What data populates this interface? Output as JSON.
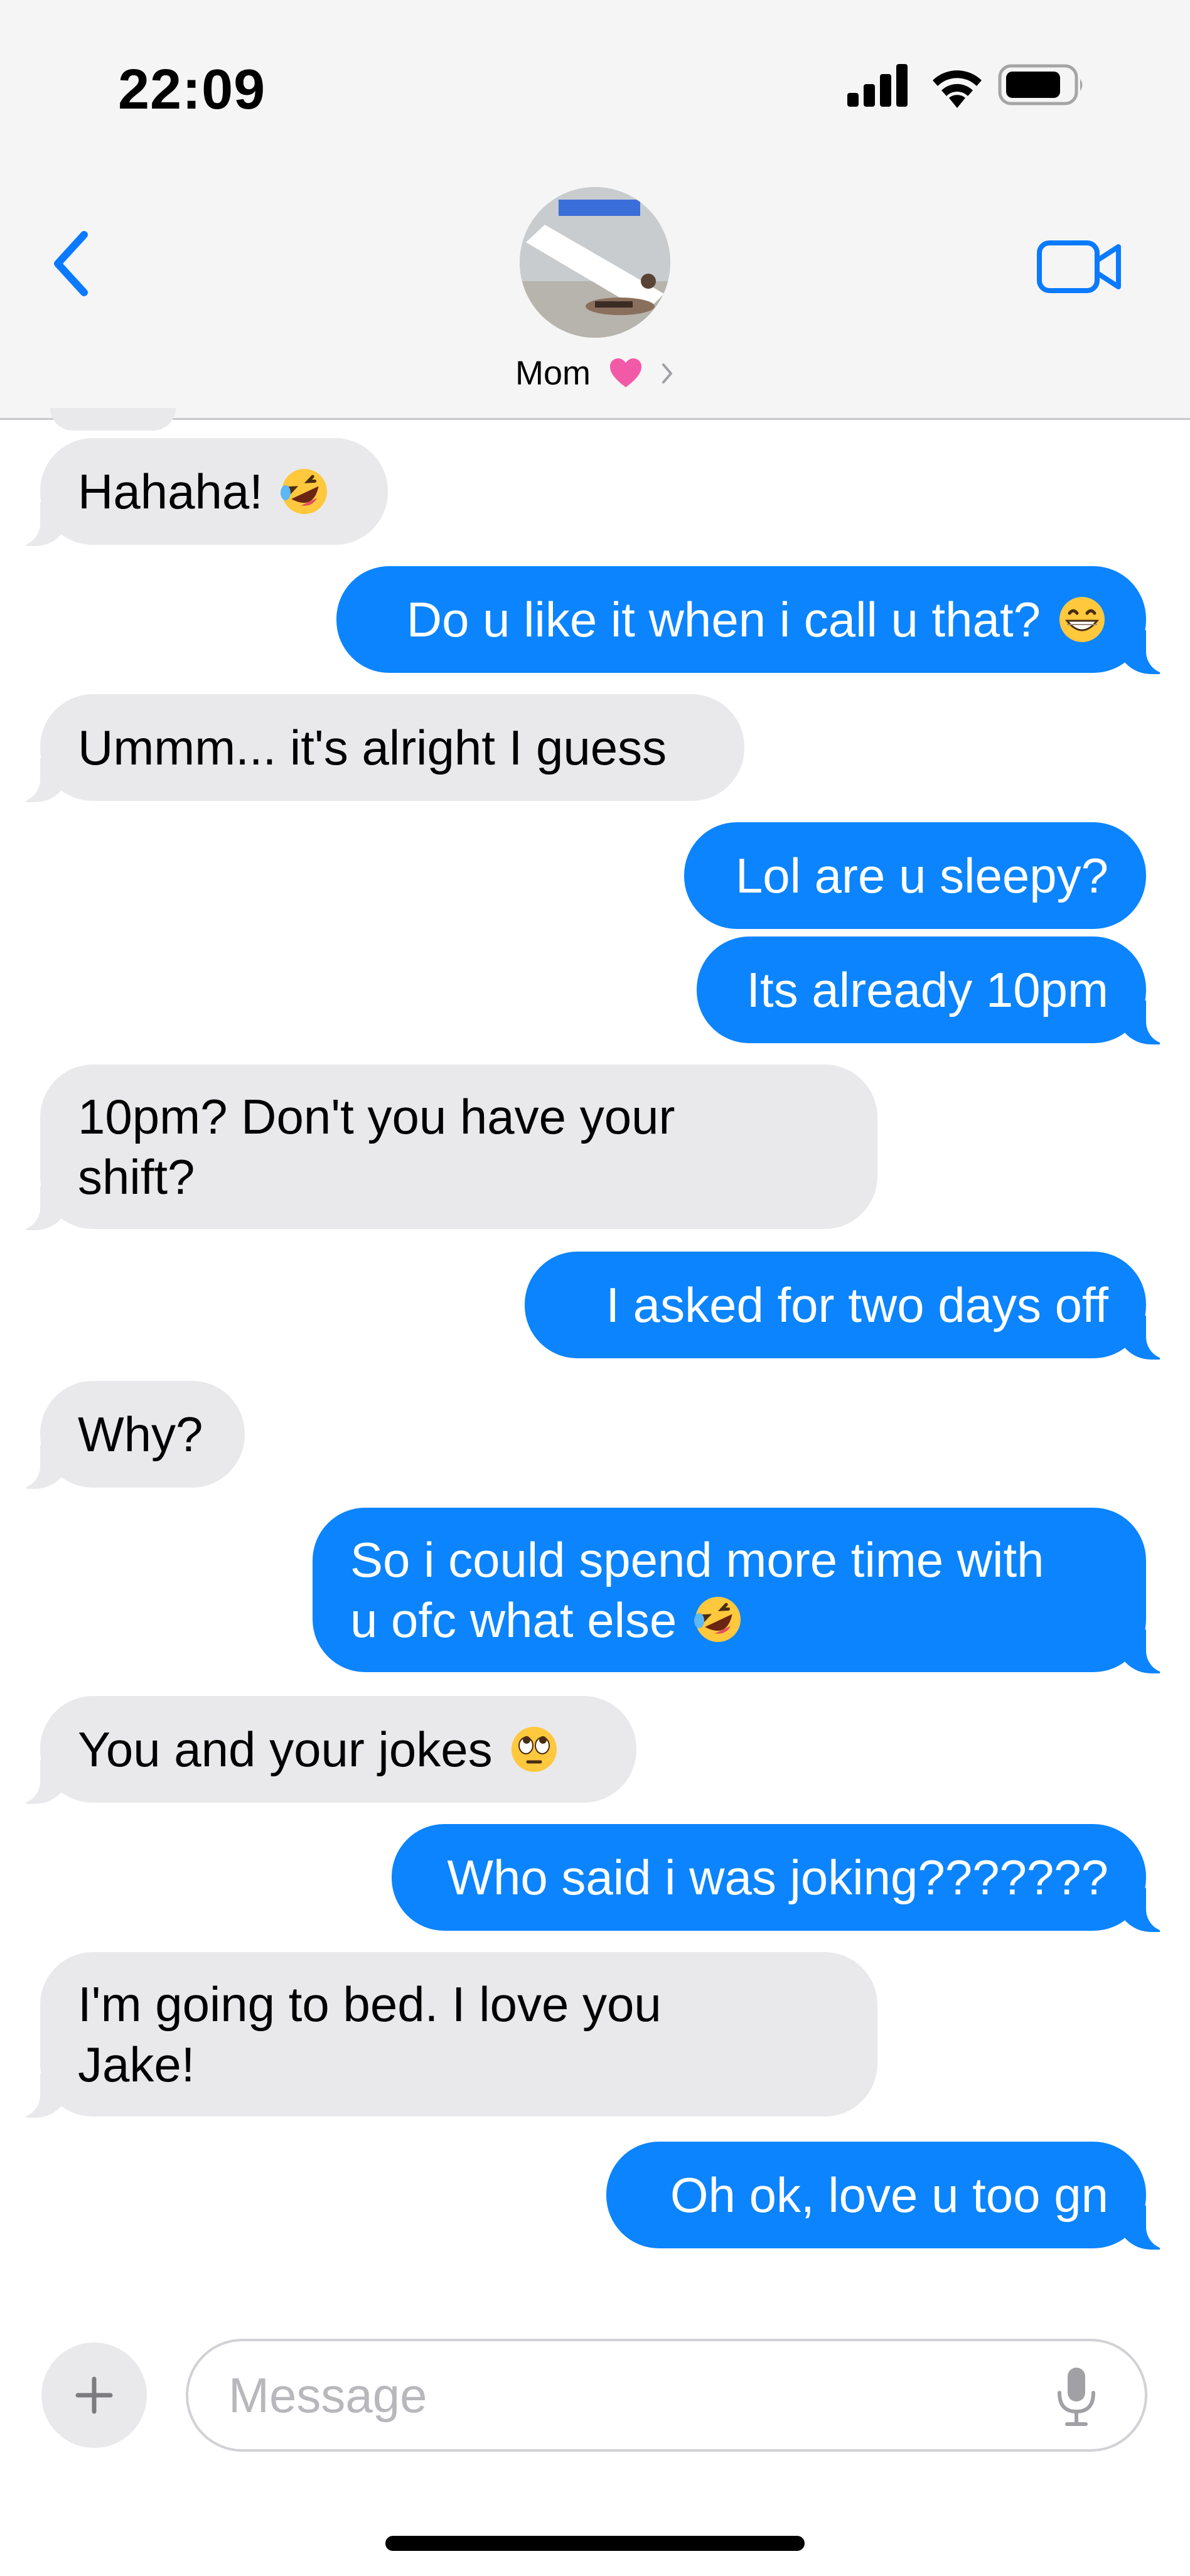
{
  "status_bar": {
    "time": "22:09",
    "icons": [
      "signal-icon",
      "wifi-icon",
      "battery-icon"
    ]
  },
  "header": {
    "back_icon": "chevron-left-icon",
    "contact_name": "Mom",
    "contact_emoji": "pink-heart",
    "video_icon": "video-camera-icon"
  },
  "colors": {
    "outgoing_bubble": "#0b84fe",
    "incoming_bubble": "#e9e9eb",
    "accent": "#0a7aff"
  },
  "messages": [
    {
      "dir": "in",
      "text": "Hahaha!",
      "emoji": "rolling-on-floor-laughing"
    },
    {
      "dir": "out",
      "text": "Do u like it when i call u that?",
      "emoji": "grinning-face"
    },
    {
      "dir": "in",
      "text": "Ummm... it's alright I guess"
    },
    {
      "dir": "out",
      "text": "Lol are u sleepy?"
    },
    {
      "dir": "out",
      "text": "Its already 10pm"
    },
    {
      "dir": "in",
      "line1": "10pm? Don't you have your",
      "line2": "shift?"
    },
    {
      "dir": "out",
      "text": "I asked for two days off"
    },
    {
      "dir": "in",
      "text": "Why?"
    },
    {
      "dir": "out",
      "line1": "So i could spend more time with",
      "line2": "u ofc what else",
      "emoji": "rolling-on-floor-laughing"
    },
    {
      "dir": "in",
      "text": "You and your jokes",
      "emoji": "face-with-rolling-eyes"
    },
    {
      "dir": "out",
      "text": "Who said i was joking???????"
    },
    {
      "dir": "in",
      "line1": "I'm going to bed. I love you",
      "line2": "Jake!"
    },
    {
      "dir": "out",
      "text": "Oh ok, love u too gn"
    }
  ],
  "input": {
    "placeholder": "Message",
    "plus_icon": "plus-icon",
    "mic_icon": "microphone-icon"
  }
}
